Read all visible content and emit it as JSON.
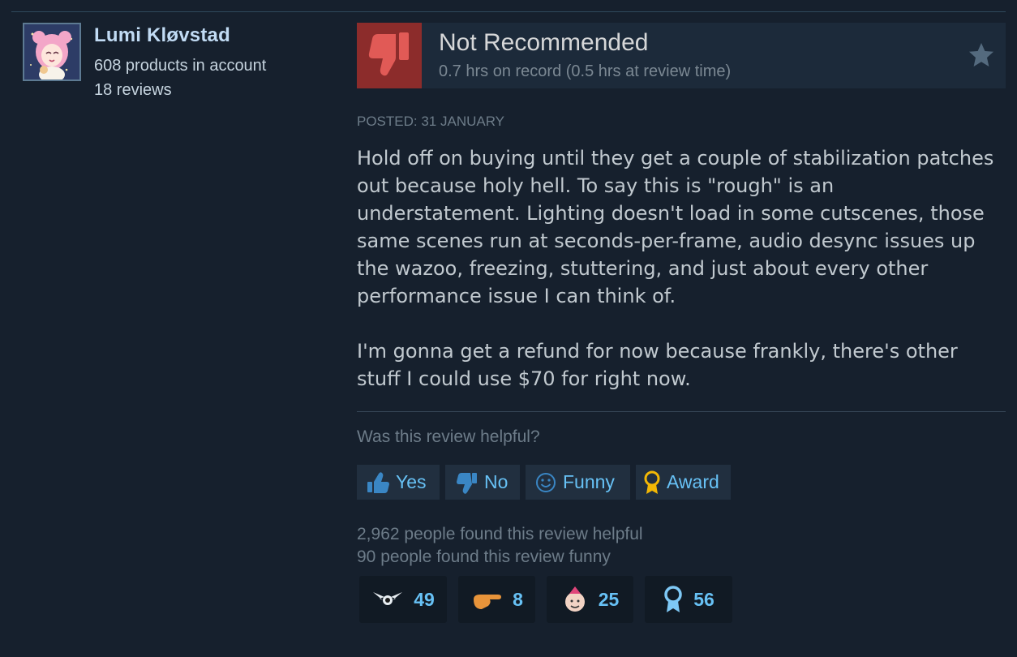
{
  "author": {
    "name": "Lumi Kløvstad",
    "products": "608 products in account",
    "reviews": "18 reviews"
  },
  "review": {
    "verdict": "Not Recommended",
    "hours": "0.7 hrs on record (0.5 hrs at review time)",
    "posted": "Posted: 31 January",
    "paragraphs": [
      "Hold off on buying until they get a couple of stabilization patches out because holy hell. To say this is \"rough\" is an understatement. Lighting doesn't load in some cutscenes, those same scenes run at seconds-per-frame, audio desync issues up the wazoo, freezing, stuttering, and just about every other performance issue I can think of.",
      "I'm gonna get a refund for now because frankly, there's other stuff I could use $70 for right now."
    ]
  },
  "feedback": {
    "question": "Was this review helpful?",
    "yes_label": "Yes",
    "no_label": "No",
    "funny_label": "Funny",
    "award_label": "Award",
    "helpful_count": "2,962 people found this review helpful",
    "funny_count": "90 people found this review funny"
  },
  "awards": [
    {
      "icon": "wings-icon",
      "count": "49"
    },
    {
      "icon": "pointing-hand-icon",
      "count": "8"
    },
    {
      "icon": "party-face-icon",
      "count": "25"
    },
    {
      "icon": "ribbon-icon",
      "count": "56"
    }
  ],
  "colors": {
    "background": "#16202d",
    "accent": "#67c1f5",
    "thumb_down_bg": "#8c2c2b",
    "author_name": "#c1dbf4"
  }
}
